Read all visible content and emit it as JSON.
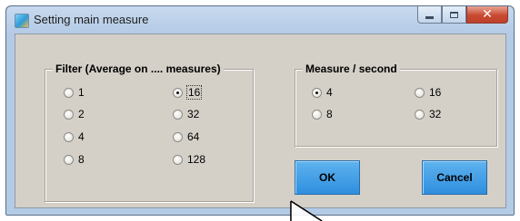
{
  "window": {
    "title": "Setting main measure",
    "icon": "app-icon"
  },
  "caption_buttons": {
    "minimize": "minimize-icon",
    "maximize": "maximize-icon",
    "close": "close-icon"
  },
  "filter_group": {
    "label": "Filter (Average on .... measures)",
    "options": [
      "1",
      "2",
      "4",
      "8",
      "16",
      "32",
      "64",
      "128"
    ],
    "selected": "16"
  },
  "rate_group": {
    "label": "Measure / second",
    "options": [
      "4",
      "8",
      "16",
      "32"
    ],
    "selected": "4"
  },
  "buttons": {
    "ok": "OK",
    "cancel": "Cancel"
  },
  "colors": {
    "button_fill": "#2e8ede",
    "client_bg": "#d4d0c8",
    "title_bg": "#b4cbe6",
    "close_red": "#c84b31"
  }
}
